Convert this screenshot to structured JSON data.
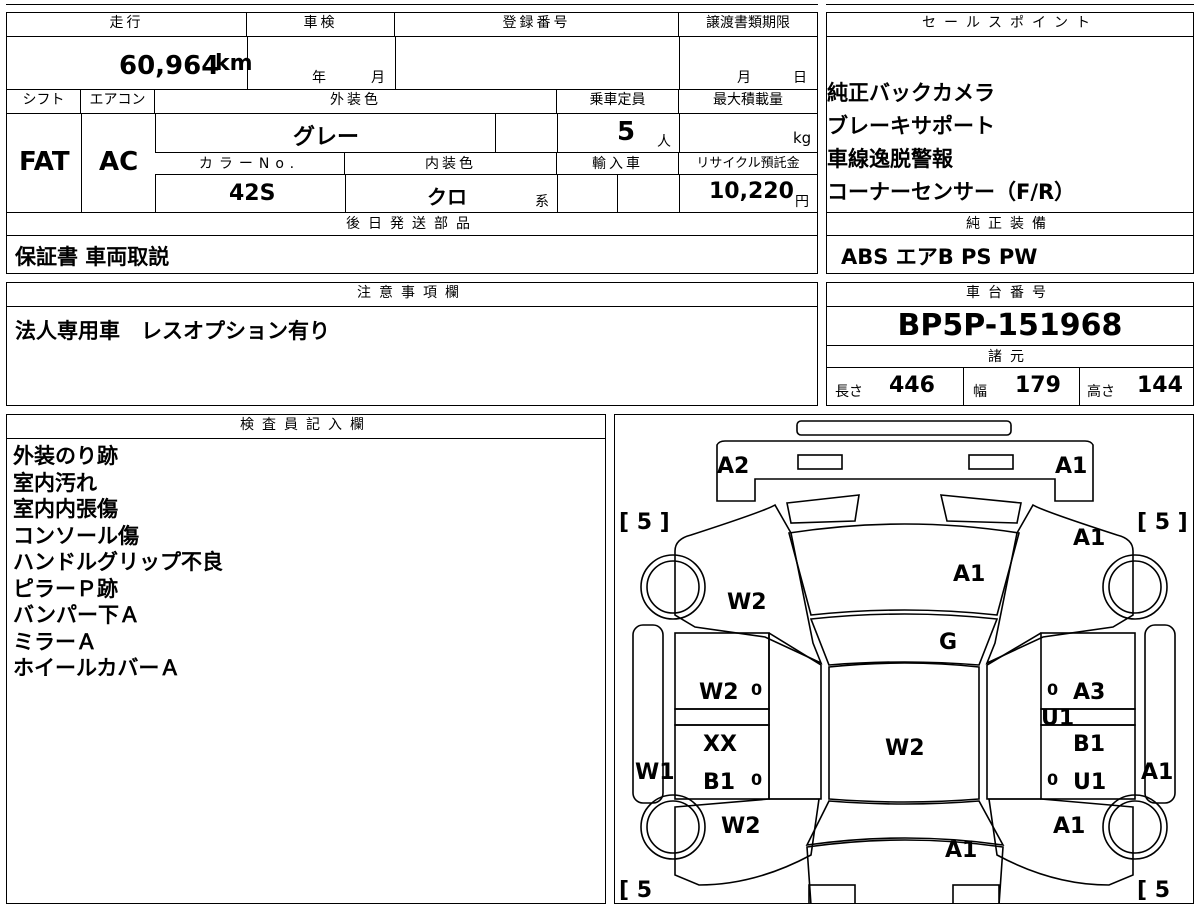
{
  "vehicle": {
    "mileage_label": "走行",
    "mileage_value": "60,964",
    "mileage_unit": "km",
    "inspection_label": "車検",
    "inspection_year": "年",
    "inspection_month": "月",
    "registration_label": "登録番号",
    "transfer_label": "譲渡書類期限",
    "transfer_month": "月",
    "transfer_day": "日",
    "shift_label": "シフト",
    "shift_value": "FAT",
    "ac_label": "エアコン",
    "ac_value": "AC",
    "exterior_label": "外装色",
    "exterior_value": "グレー",
    "capacity_label": "乗車定員",
    "capacity_value": "5",
    "capacity_unit": "人",
    "load_label": "最大積載量",
    "load_unit": "kg",
    "color_no_label": "カラーNo.",
    "color_no_value": "42S",
    "interior_label": "内装色",
    "interior_value": "クロ",
    "interior_unit": "系",
    "import_label": "輸入車",
    "recycle_label": "リサイクル預託金",
    "recycle_value": "10,220",
    "recycle_unit": "円"
  },
  "later_parts": {
    "label": "後日発送部品",
    "value": "保証書 車両取説"
  },
  "notes": {
    "label": "注意事項欄",
    "value": "法人専用車　レスオプション有り"
  },
  "sales_points": {
    "label": "セールスポイント",
    "items": [
      "純正バックカメラ",
      "ブレーキサポート",
      "車線逸脱警報",
      "コーナーセンサー（F/R）"
    ]
  },
  "equipment": {
    "label": "純正装備",
    "value": "ABS エアB PS PW"
  },
  "chassis": {
    "label": "車台番号",
    "value": "BP5P-151968"
  },
  "specs": {
    "label": "諸元",
    "length_label": "長さ",
    "length_value": "446",
    "width_label": "幅",
    "width_value": "179",
    "height_label": "高さ",
    "height_value": "144"
  },
  "inspector": {
    "label": "検査員記入欄",
    "items": [
      "外装のり跡",
      "室内汚れ",
      "室内内張傷",
      "コンソール傷",
      "ハンドルグリップ不良",
      "ピラーＰ跡",
      "バンパー下Ａ",
      "ミラーＡ",
      "ホイールカバーＡ"
    ]
  },
  "diagram": {
    "marks": {
      "front_left": "A2",
      "front_right": "A1",
      "hood": "A1",
      "windshield": "G",
      "front_fender_left": "W2",
      "front_fender_right": "A1",
      "front_door_left": "W2",
      "front_door_right": "A3",
      "right_center": "U1",
      "rear_door_left_1": "XX",
      "rear_door_left_2": "B1",
      "rear_door_right_1": "B1",
      "rear_door_right_2": "U1",
      "roof": "W2",
      "rocker_left": "W1",
      "rocker_right": "A1",
      "rear_fender_left": "W2",
      "rear_fender_right": "A1",
      "trunk": "A1",
      "zero": "0"
    },
    "tire_tl": "[ 5 ]",
    "tire_tr": "[ 5 ]",
    "tire_bl": "[ 5",
    "tire_br": "[ 5"
  }
}
